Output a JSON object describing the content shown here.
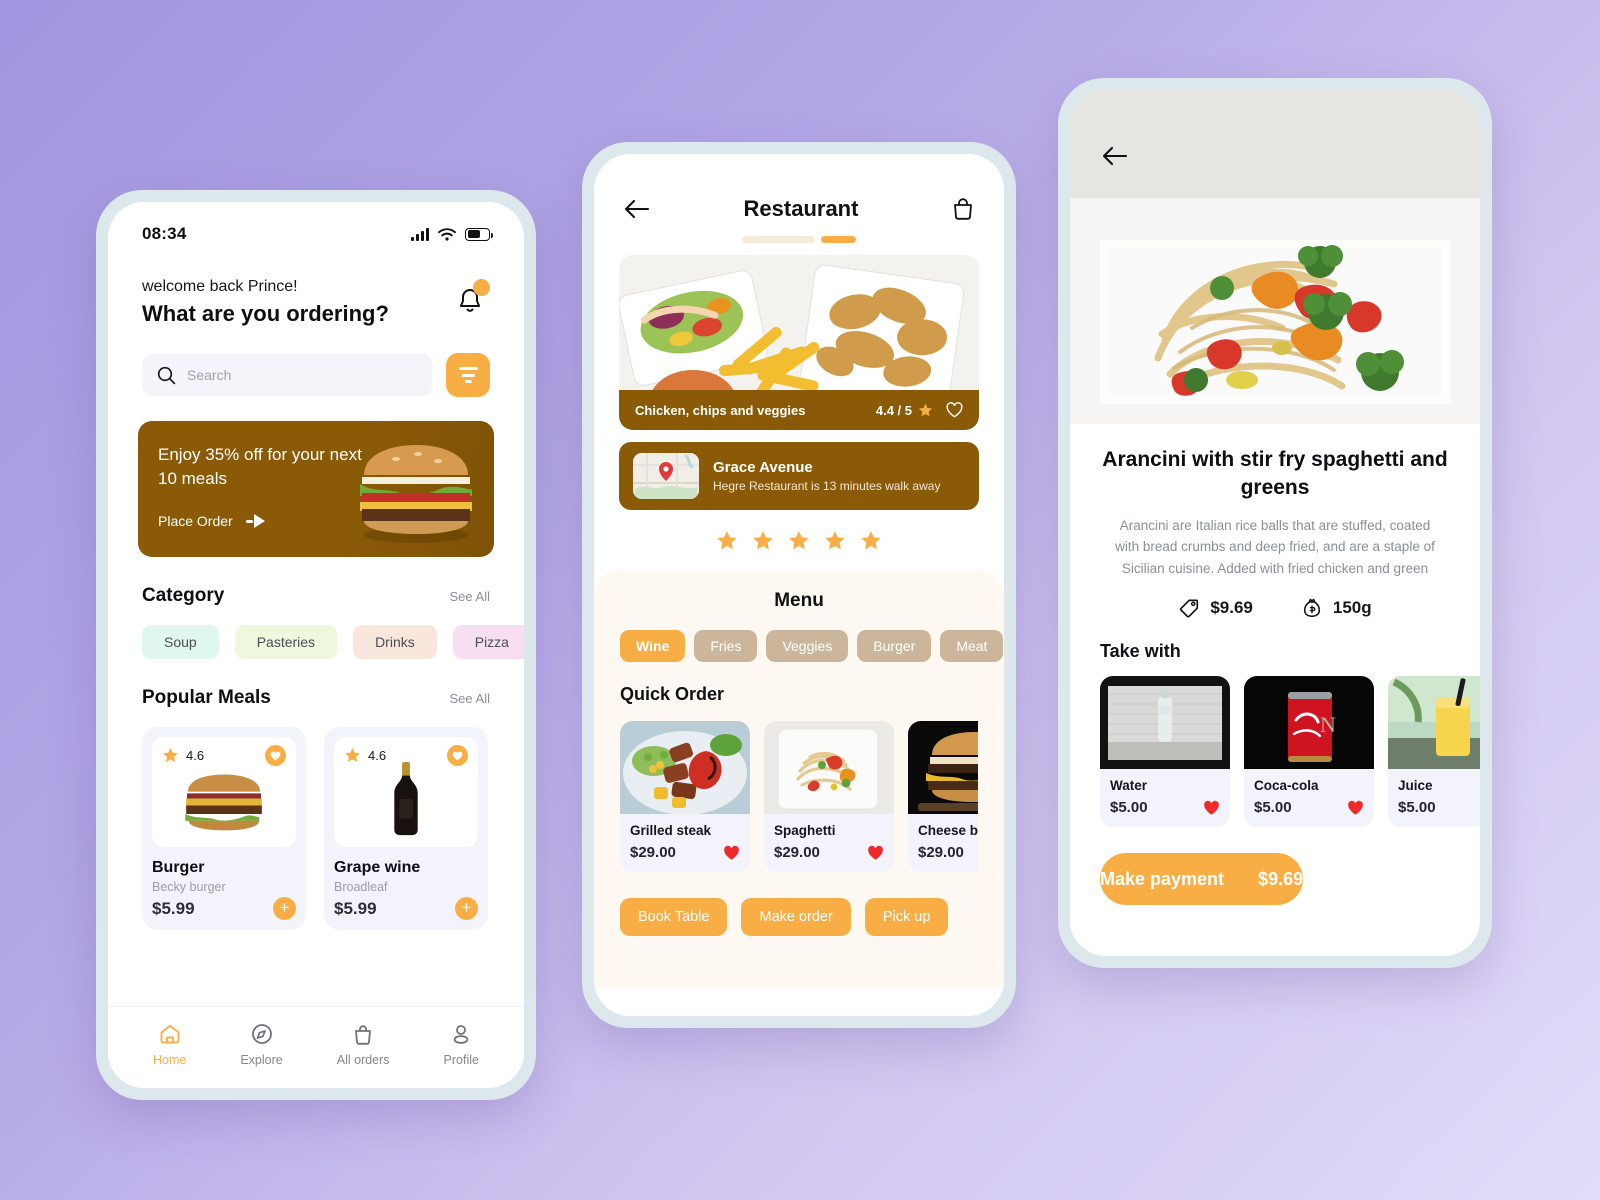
{
  "theme": {
    "accent": "#f9ae45",
    "brown": "#8a5a06",
    "cream": "#fdf8f1",
    "card": "#f3f3fb",
    "bg_from": "#a396e0",
    "bg_to": "#e2dcf9"
  },
  "home": {
    "status": {
      "time": "08:34"
    },
    "greeting_small": "welcome back Prince!",
    "greeting_big": "What are you ordering?",
    "search": {
      "value": "",
      "placeholder": "Search"
    },
    "promo": {
      "title": "Enjoy 35% off for your next 10 meals",
      "cta": "Place Order"
    },
    "category": {
      "title": "Category",
      "see_all": "See All",
      "items": [
        {
          "label": "Soup",
          "color": "#dff7ec"
        },
        {
          "label": "Pasteries",
          "color": "#eef8dc"
        },
        {
          "label": "Drinks",
          "color": "#fae7dc"
        },
        {
          "label": "Pizza",
          "color": "#f7dff1"
        }
      ]
    },
    "popular": {
      "title": "Popular Meals",
      "see_all": "See All",
      "items": [
        {
          "rating": "4.6",
          "name": "Burger",
          "sub": "Becky burger",
          "price": "$5.99",
          "add": "+"
        },
        {
          "rating": "4.6",
          "name": "Grape wine",
          "sub": "Broadleaf",
          "price": "$5.99",
          "add": "+"
        }
      ]
    },
    "tabs": [
      {
        "label": "Home",
        "icon": "home-icon",
        "active": true
      },
      {
        "label": "Explore",
        "icon": "compass-icon",
        "active": false
      },
      {
        "label": "All orders",
        "icon": "bag-icon",
        "active": false
      },
      {
        "label": "Profile",
        "icon": "person-icon",
        "active": false
      }
    ]
  },
  "restaurant": {
    "title": "Restaurant",
    "hero": {
      "caption": "Chicken, chips and veggies",
      "rating": "4.4 / 5"
    },
    "address": {
      "name": "Grace Avenue",
      "detail": "Hegre Restaurant is 13 minutes walk away"
    },
    "star_count": 5,
    "menu": {
      "title": "Menu",
      "chips": [
        {
          "label": "Wine",
          "active": true
        },
        {
          "label": "Fries",
          "active": false
        },
        {
          "label": "Veggies",
          "active": false
        },
        {
          "label": "Burger",
          "active": false
        },
        {
          "label": "Meat",
          "active": false
        }
      ]
    },
    "quick_order": {
      "title": "Quick Order",
      "items": [
        {
          "name": "Grilled steak",
          "price": "$29.00",
          "liked": true
        },
        {
          "name": "Spaghetti",
          "price": "$29.00",
          "liked": true
        },
        {
          "name": "Cheese burger",
          "price": "$29.00",
          "liked": true
        }
      ]
    },
    "actions": [
      "Book Table",
      "Make order",
      "Pick up"
    ]
  },
  "detail": {
    "title": "Arancini with stir fry spaghetti and greens",
    "description": "Arancini are Italian rice balls that are stuffed, coated with bread crumbs and deep fried, and are a staple of Sicilian cuisine. Added with fried chicken and green",
    "price": "$9.69",
    "weight": "150g",
    "take_with_title": "Take with",
    "take_with": [
      {
        "name": "Water",
        "price": "$5.00",
        "liked": true
      },
      {
        "name": "Coca-cola",
        "price": "$5.00",
        "liked": true
      },
      {
        "name": "Juice",
        "price": "$5.00",
        "liked": true
      }
    ],
    "pay": {
      "label": "Make payment",
      "amount": "$9.69"
    }
  }
}
